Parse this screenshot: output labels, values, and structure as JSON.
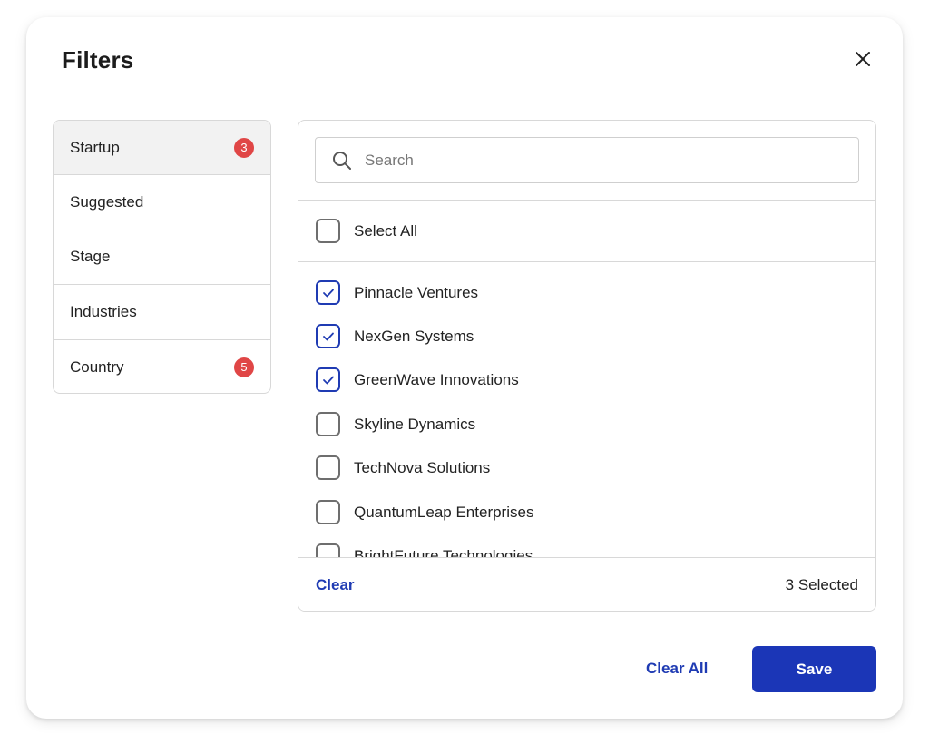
{
  "modal": {
    "title": "Filters"
  },
  "categories": [
    {
      "label": "Startup",
      "badge": "3",
      "active": true
    },
    {
      "label": "Suggested",
      "badge": "",
      "active": false
    },
    {
      "label": "Stage",
      "badge": "",
      "active": false
    },
    {
      "label": "Industries",
      "badge": "",
      "active": false
    },
    {
      "label": "Country",
      "badge": "5",
      "active": false
    }
  ],
  "search": {
    "placeholder": "Search",
    "value": ""
  },
  "select_all": {
    "label": "Select All",
    "checked": false
  },
  "options": [
    {
      "label": "Pinnacle Ventures",
      "checked": true
    },
    {
      "label": "NexGen Systems",
      "checked": true
    },
    {
      "label": "GreenWave Innovations",
      "checked": true
    },
    {
      "label": "Skyline Dynamics",
      "checked": false
    },
    {
      "label": "TechNova Solutions",
      "checked": false
    },
    {
      "label": "QuantumLeap Enterprises",
      "checked": false
    },
    {
      "label": "BrightFuture Technologies",
      "checked": false
    }
  ],
  "panel_footer": {
    "clear_label": "Clear",
    "selected_count": "3 Selected"
  },
  "actions": {
    "clear_all_label": "Clear All",
    "save_label": "Save"
  },
  "icons": {
    "close": "close-icon",
    "search": "search-icon",
    "check": "check-icon"
  },
  "colors": {
    "accent": "#1b36b7",
    "badge": "#e04646",
    "active_bg": "#f2f2f2"
  }
}
